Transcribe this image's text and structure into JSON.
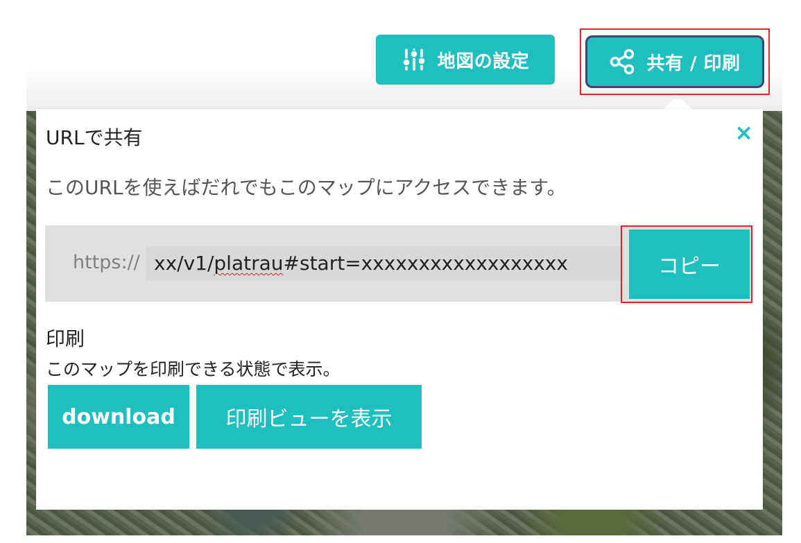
{
  "header": {
    "settings_label": "地図の設定",
    "share_label": "共有 / 印刷",
    "accent_color": "#1fbfbf",
    "highlight_color": "#e8202a"
  },
  "share_panel": {
    "title": "URLで共有",
    "close_symbol": "×",
    "description": "このURLを使えばだれでもこのマップにアクセスできます。",
    "url_prefix": "https://",
    "url_value_part1": "xx/v1/",
    "url_value_spell": "platrau",
    "url_value_part2": "#start=xxxxxxxxxxxxxxxxxx",
    "copy_label": "コピー"
  },
  "print_section": {
    "label": "印刷",
    "description": "このマップを印刷できる状態で表示。",
    "download_label": "download",
    "print_view_label": "印刷ビューを表示"
  },
  "icons": {
    "settings": "sliders-icon",
    "share": "share-icon",
    "close": "close-icon"
  }
}
